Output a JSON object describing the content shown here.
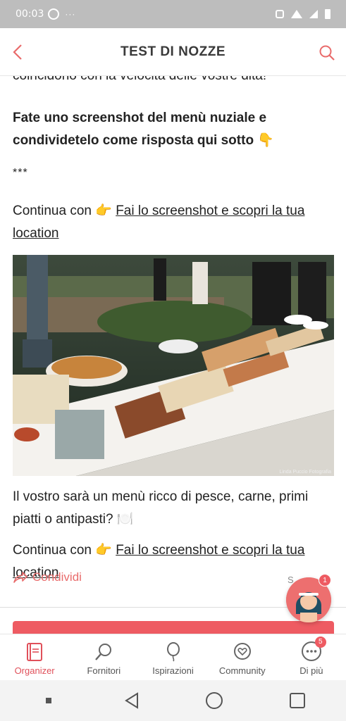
{
  "status_bar": {
    "time": "00:03"
  },
  "header": {
    "title": "TEST DI NOZZE"
  },
  "content": {
    "partial_line": "coincidono con la velocità delle vostre dita!",
    "bold_text": "Fate uno screenshot del menù nuziale e condividetelo come risposta qui sotto 👇",
    "stars": "***",
    "continue_prefix": "Continua con 👉 ",
    "continue_link": "Fai lo screenshot e scopri la tua location",
    "photo_credit": "Linda Puccio Fotografia",
    "caption": "Il vostro sarà un menù ricco di pesce, carne, primi piatti o antipasti? 🍽️",
    "continue2_prefix": "Continua con 👉 ",
    "continue2_link": "Fai lo screenshot e scopri la tua location"
  },
  "share": {
    "label": "Condividi"
  },
  "fab": {
    "badge": "1",
    "behind_text": "S"
  },
  "bottom_nav": {
    "items": [
      {
        "label": "Organizer",
        "active": true
      },
      {
        "label": "Fornitori"
      },
      {
        "label": "Ispirazioni"
      },
      {
        "label": "Community"
      },
      {
        "label": "Di più",
        "badge": "5"
      }
    ]
  },
  "colors": {
    "accent": "#e0505a",
    "pink_bar": "#ee5b62",
    "status_bar": "#bdbdbd"
  }
}
